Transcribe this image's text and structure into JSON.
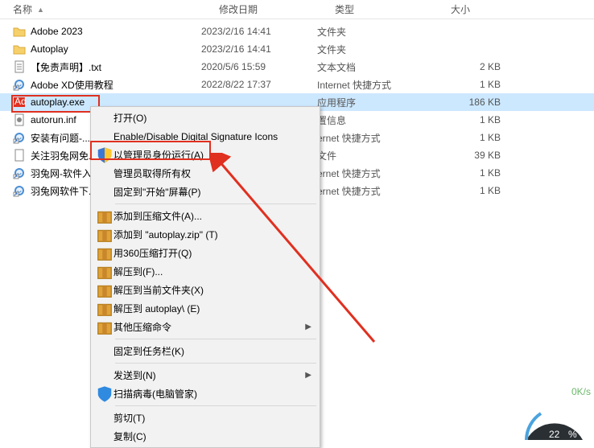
{
  "columns": {
    "name": "名称",
    "date": "修改日期",
    "type": "类型",
    "size": "大小"
  },
  "files": [
    {
      "name": "Adobe 2023",
      "date": "2023/2/16 14:41",
      "type": "文件夹",
      "size": "",
      "icon": "folder"
    },
    {
      "name": "Autoplay",
      "date": "2023/2/16 14:41",
      "type": "文件夹",
      "size": "",
      "icon": "folder"
    },
    {
      "name": "【免责声明】.txt",
      "date": "2020/5/6 15:59",
      "type": "文本文档",
      "size": "2 KB",
      "icon": "txt"
    },
    {
      "name": "Adobe XD使用教程",
      "date": "2022/8/22 17:37",
      "type": "Internet 快捷方式",
      "size": "1 KB",
      "icon": "shortcut"
    },
    {
      "name": "autoplay.exe",
      "date": "",
      "type": "应用程序",
      "size": "186 KB",
      "icon": "exe",
      "selected": true
    },
    {
      "name": "autorun.inf",
      "date": "",
      "type": "置信息",
      "size": "1 KB",
      "icon": "config"
    },
    {
      "name": "安装有问题-...",
      "date": "",
      "type": "ernet 快捷方式",
      "size": "1 KB",
      "icon": "shortcut"
    },
    {
      "name": "关注羽兔网免...",
      "date": "",
      "type": "文件",
      "size": "39 KB",
      "icon": "file"
    },
    {
      "name": "羽兔网-软件入...",
      "date": "",
      "type": "ernet 快捷方式",
      "size": "1 KB",
      "icon": "shortcut"
    },
    {
      "name": "羽兔网软件下...",
      "date": "",
      "type": "ernet 快捷方式",
      "size": "1 KB",
      "icon": "shortcut"
    }
  ],
  "menu": {
    "open": "打开(O)",
    "enableDisable": "Enable/Disable Digital Signature Icons",
    "runAsAdmin": "以管理员身份运行(A)",
    "takeOwnership": "管理员取得所有权",
    "pinStart": "固定到\"开始\"屏幕(P)",
    "addArchive": "添加到压缩文件(A)...",
    "addZip": "添加到 \"autoplay.zip\" (T)",
    "open360": "用360压缩打开(Q)",
    "extractTo": "解压到(F)...",
    "extractHere": "解压到当前文件夹(X)",
    "extractAutoplay": "解压到 autoplay\\ (E)",
    "otherCompress": "其他压缩命令",
    "pinTaskbar": "固定到任务栏(K)",
    "sendTo": "发送到(N)",
    "scanVirus": "扫描病毒(电脑管家)",
    "cut": "剪切(T)",
    "copy": "复制(C)"
  },
  "gauge": {
    "percent": "22",
    "unit": "%"
  },
  "net": {
    "up": "0K/s"
  }
}
